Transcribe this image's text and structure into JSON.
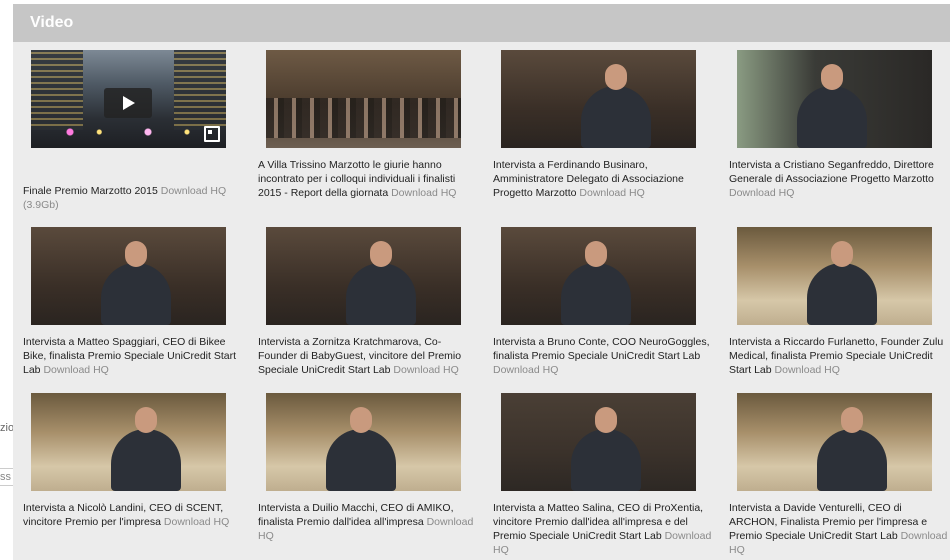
{
  "edge_fragments": [
    "zio",
    "ss"
  ],
  "section": {
    "title": "Video"
  },
  "download_label": "Download HQ",
  "videos": [
    {
      "title": "Finale Premio Marzotto 2015",
      "size": "(3.9Gb)",
      "scene": "city",
      "has_player": true
    },
    {
      "title": "A Villa Trissino Marzotto le giurie hanno incontrato per i colloqui individuali i finalisti 2015 - Report della giornata",
      "scene": "hall"
    },
    {
      "title": "Intervista a Ferdinando Businaro, Amministratore Delegato di Associazione Progetto Marzotto",
      "scene": "fire"
    },
    {
      "title": "Intervista a Cristiano Seganfreddo, Direttore Generale di Associazione Progetto Marzotto",
      "scene": "shelf"
    },
    {
      "title": "Intervista a Matteo Spaggiari, CEO di Bikee Bike, finalista Premio Speciale UniCredit Start Lab",
      "scene": "fire"
    },
    {
      "title": "Intervista a Zornitza Kratchmarova, Co-Founder di BabyGuest, vincitore del Premio Speciale UniCredit Start Lab",
      "scene": "fire"
    },
    {
      "title": "Intervista a Bruno Conte, COO NeuroGoggles, finalista Premio Speciale UniCredit Start Lab",
      "scene": "fire"
    },
    {
      "title": "Intervista a Riccardo Furlanetto, Founder Zulu Medical, finalista Premio Speciale UniCredit Start Lab",
      "scene": "tap"
    },
    {
      "title": "Intervista a Nicolò Landini, CEO di SCENT, vincitore Premio per l'impresa",
      "scene": "tap"
    },
    {
      "title": "Intervista a Duilio Macchi, CEO di AMIKO, finalista Premio dall'idea all'impresa",
      "scene": "tap"
    },
    {
      "title": "Intervista a Matteo Salina, CEO di ProXentia, vincitore Premio dall'idea all'impresa e del Premio Speciale UniCredit Start Lab",
      "scene": "dark"
    },
    {
      "title": "Intervista a Davide Venturelli, CEO di ARCHON, Finalista Premio per l'impresa e Premio Speciale UniCredit Start Lab",
      "scene": "tap"
    }
  ]
}
